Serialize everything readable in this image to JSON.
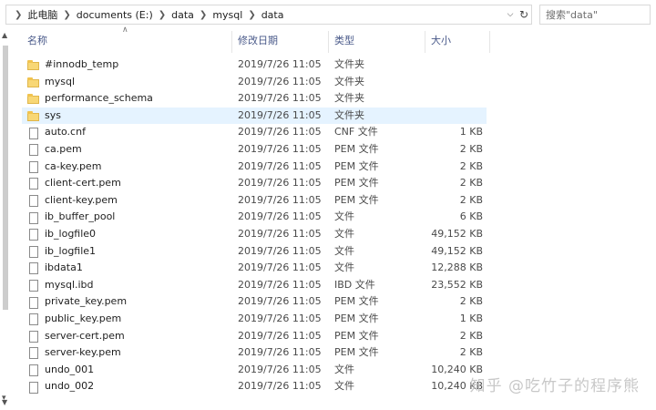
{
  "address_bar": {
    "breadcrumbs": [
      "此电脑",
      "documents (E:)",
      "data",
      "mysql",
      "data"
    ]
  },
  "search": {
    "placeholder": "搜索\"data\""
  },
  "columns": {
    "name": "名称",
    "date": "修改日期",
    "type": "类型",
    "size": "大小"
  },
  "files": [
    {
      "name": "#innodb_temp",
      "date": "2019/7/26 11:05",
      "type": "文件夹",
      "size": "",
      "icon": "folder-icon"
    },
    {
      "name": "mysql",
      "date": "2019/7/26 11:05",
      "type": "文件夹",
      "size": "",
      "icon": "folder-icon"
    },
    {
      "name": "performance_schema",
      "date": "2019/7/26 11:05",
      "type": "文件夹",
      "size": "",
      "icon": "folder-icon"
    },
    {
      "name": "sys",
      "date": "2019/7/26 11:05",
      "type": "文件夹",
      "size": "",
      "icon": "folder-icon",
      "selected": true
    },
    {
      "name": "auto.cnf",
      "date": "2019/7/26 11:05",
      "type": "CNF 文件",
      "size": "1 KB",
      "icon": "file-icon"
    },
    {
      "name": "ca.pem",
      "date": "2019/7/26 11:05",
      "type": "PEM 文件",
      "size": "2 KB",
      "icon": "file-icon"
    },
    {
      "name": "ca-key.pem",
      "date": "2019/7/26 11:05",
      "type": "PEM 文件",
      "size": "2 KB",
      "icon": "file-icon"
    },
    {
      "name": "client-cert.pem",
      "date": "2019/7/26 11:05",
      "type": "PEM 文件",
      "size": "2 KB",
      "icon": "file-icon"
    },
    {
      "name": "client-key.pem",
      "date": "2019/7/26 11:05",
      "type": "PEM 文件",
      "size": "2 KB",
      "icon": "file-icon"
    },
    {
      "name": "ib_buffer_pool",
      "date": "2019/7/26 11:05",
      "type": "文件",
      "size": "6 KB",
      "icon": "file-icon"
    },
    {
      "name": "ib_logfile0",
      "date": "2019/7/26 11:05",
      "type": "文件",
      "size": "49,152 KB",
      "icon": "file-icon"
    },
    {
      "name": "ib_logfile1",
      "date": "2019/7/26 11:05",
      "type": "文件",
      "size": "49,152 KB",
      "icon": "file-icon"
    },
    {
      "name": "ibdata1",
      "date": "2019/7/26 11:05",
      "type": "文件",
      "size": "12,288 KB",
      "icon": "file-icon"
    },
    {
      "name": "mysql.ibd",
      "date": "2019/7/26 11:05",
      "type": "IBD 文件",
      "size": "23,552 KB",
      "icon": "file-icon"
    },
    {
      "name": "private_key.pem",
      "date": "2019/7/26 11:05",
      "type": "PEM 文件",
      "size": "2 KB",
      "icon": "file-icon"
    },
    {
      "name": "public_key.pem",
      "date": "2019/7/26 11:05",
      "type": "PEM 文件",
      "size": "1 KB",
      "icon": "file-icon"
    },
    {
      "name": "server-cert.pem",
      "date": "2019/7/26 11:05",
      "type": "PEM 文件",
      "size": "2 KB",
      "icon": "file-icon"
    },
    {
      "name": "server-key.pem",
      "date": "2019/7/26 11:05",
      "type": "PEM 文件",
      "size": "2 KB",
      "icon": "file-icon"
    },
    {
      "name": "undo_001",
      "date": "2019/7/26 11:05",
      "type": "文件",
      "size": "10,240 KB",
      "icon": "file-icon"
    },
    {
      "name": "undo_002",
      "date": "2019/7/26 11:05",
      "type": "文件",
      "size": "10,240 KB",
      "icon": "file-icon"
    }
  ],
  "watermark": "知乎 @吃竹子的程序熊"
}
